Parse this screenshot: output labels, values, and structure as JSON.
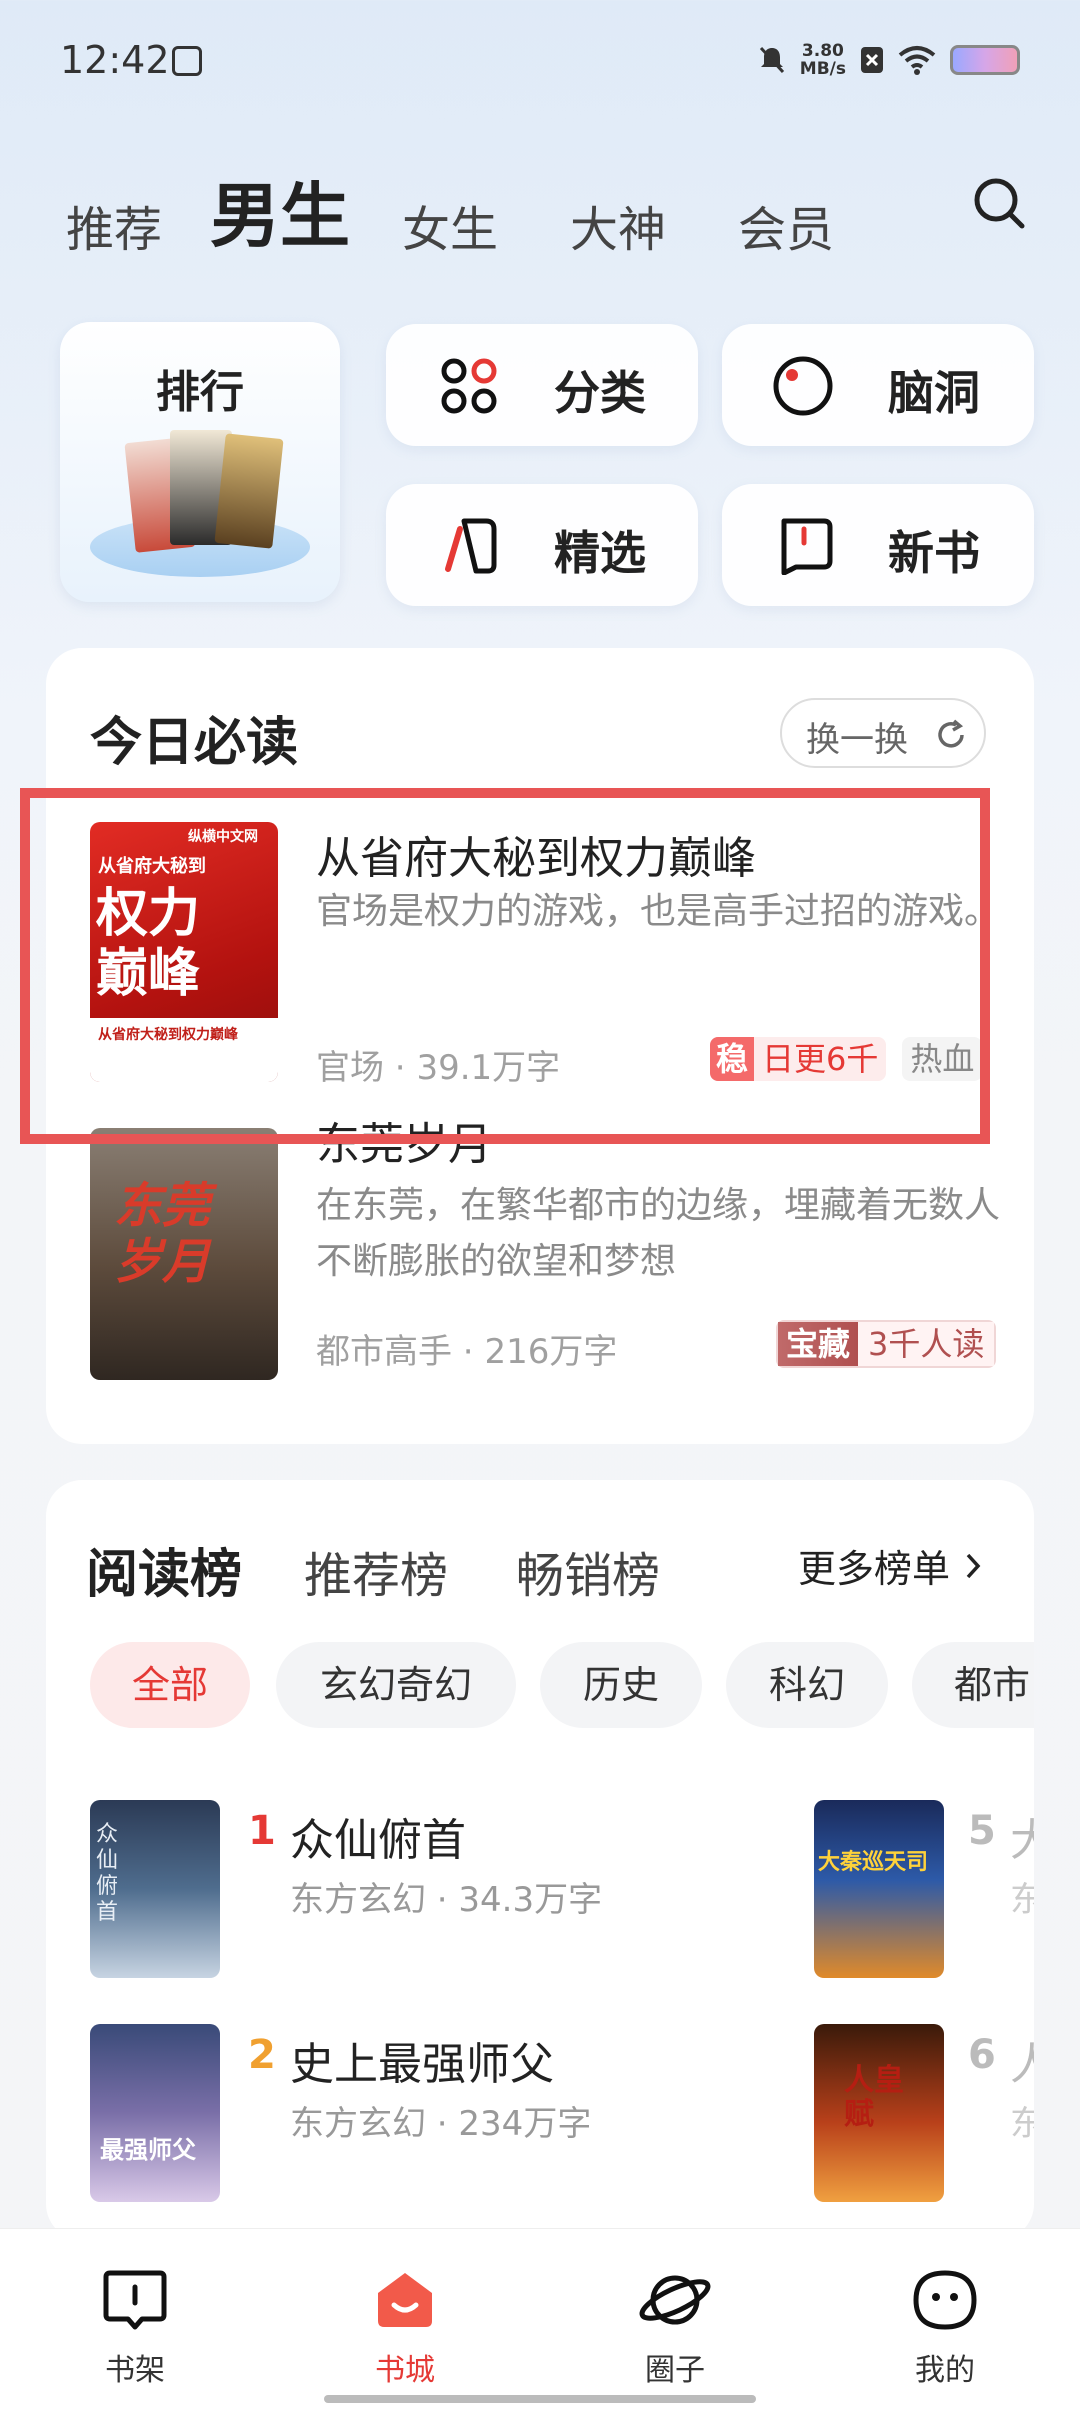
{
  "status": {
    "time": "12:42",
    "speed": "3.80",
    "speed_unit": "MB/s"
  },
  "top_tabs": [
    "推荐",
    "男生",
    "女生",
    "大神",
    "会员"
  ],
  "quick": {
    "rank": "排行",
    "category": "分类",
    "brain": "脑洞",
    "selected": "精选",
    "new_books": "新书"
  },
  "today": {
    "title": "今日必读",
    "refresh": "换一换",
    "books": [
      {
        "title": "从省府大秘到权力巅峰",
        "desc": "官场是权力的游戏，也是高手过招的游戏。",
        "category": "官场",
        "words": "39.1万字",
        "badge": "稳",
        "update": "日更6千",
        "extra": "热血",
        "cover_small": "从省府大秘到",
        "cover_big": "权力巅峰",
        "cover_logo": "纵横中文网",
        "cover_foot": "从省府大秘到权力巅峰"
      },
      {
        "title": "东莞岁月",
        "desc": "在东莞，在繁华都市的边缘，埋藏着无数人不断膨胀的欲望和梦想",
        "category": "都市高手",
        "words": "216万字",
        "badge": "宝藏",
        "update": "3千人读",
        "cover_big": "东莞岁月"
      }
    ]
  },
  "ranking": {
    "tabs": [
      "阅读榜",
      "推荐榜",
      "畅销榜"
    ],
    "more": "更多榜单",
    "chips": [
      "全部",
      "玄幻奇幻",
      "历史",
      "科幻",
      "都市"
    ],
    "items": [
      {
        "num": "1",
        "name": "众仙俯首",
        "meta": "东方玄幻 · 34.3万字",
        "cover": "众仙俯首"
      },
      {
        "num": "2",
        "name": "史上最强师父",
        "meta": "东方玄幻 · 234万字",
        "cover": "最强师父"
      },
      {
        "num": "5",
        "name": "大",
        "meta": "东",
        "cover": "大秦巡天司"
      },
      {
        "num": "6",
        "name": "人",
        "meta": "东",
        "cover": "人皇赋"
      }
    ]
  },
  "nav": [
    "书架",
    "书城",
    "圈子",
    "我的"
  ],
  "colors": {
    "accent": "#e53935",
    "highlight_border": "#e85555"
  }
}
